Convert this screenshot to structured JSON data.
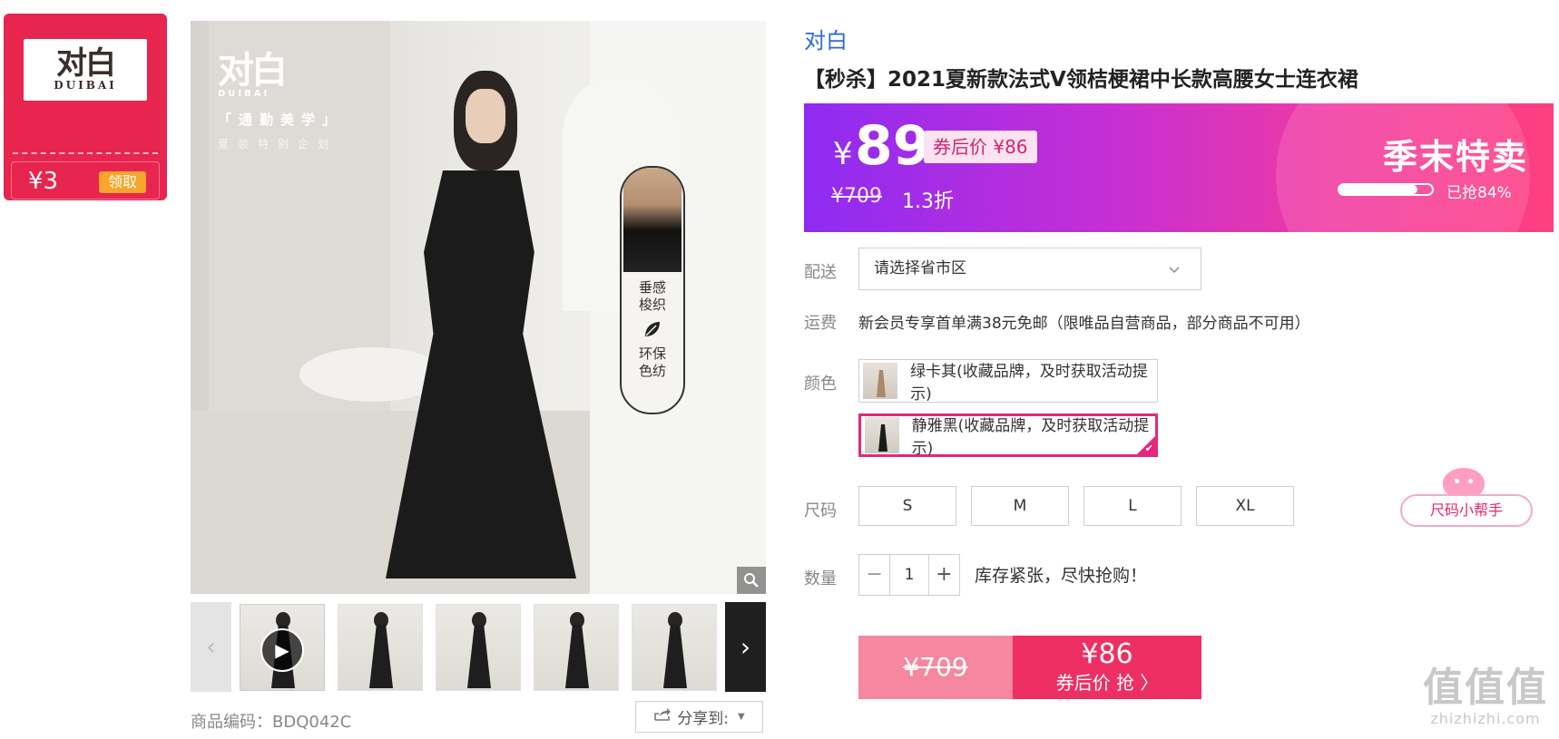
{
  "coupon": {
    "logo_glyph": "对白",
    "logo_sub": "DUIBAI",
    "amount": "¥3",
    "get_label": "领取"
  },
  "main_image": {
    "brand_glyph": "对白",
    "brand_sub": "DUIBAI",
    "tagline": "「通勤美学」",
    "subtagline": "夏装特别企划",
    "fabric_line1": "垂感",
    "fabric_line2": "梭织",
    "eco_line1": "环保",
    "eco_line2": "色纺"
  },
  "sku": {
    "label": "商品编码：BDQ042C"
  },
  "share": {
    "label": "分享到:"
  },
  "product": {
    "brand": "对白",
    "title": "【秒杀】2021夏新款法式V领桔梗裙中长款高腰女士连衣裙"
  },
  "price": {
    "currency": "¥",
    "current": "89",
    "coupon_price": "券后价 ¥86",
    "original": "¥709",
    "discount": "1.3折",
    "season_label": "季末特卖",
    "sold_text": "已抢84%",
    "sold_fraction": 0.84
  },
  "delivery": {
    "label": "配送",
    "placeholder": "请选择省市区"
  },
  "shipping": {
    "label": "运费",
    "text": "新会员专享首单满38元免邮（限唯品自营商品，部分商品不可用）"
  },
  "colors": {
    "label": "颜色",
    "options": [
      {
        "text": "绿卡其(收藏品牌，及时获取活动提示)",
        "selected": false
      },
      {
        "text": "静雅黑(收藏品牌，及时获取活动提示)",
        "selected": true
      }
    ]
  },
  "sizes": {
    "label": "尺码",
    "options": [
      "S",
      "M",
      "L",
      "XL"
    ],
    "helper": "尺码小帮手"
  },
  "quantity": {
    "label": "数量",
    "value": "1",
    "minus": "−",
    "plus": "+",
    "stock_text": "库存紧张，尽快抢购！"
  },
  "buy": {
    "original": "¥709",
    "price": "¥86",
    "label": "券后价 抢 〉"
  },
  "watermark": {
    "main": "值值值",
    "domain": "zhizhizhi.com"
  },
  "colors_theme": {
    "accent": "#ee2f63",
    "brand_blue": "#2b6cd4",
    "coupon_red": "#e8254f",
    "banner_purple": "#8e2bf2"
  }
}
